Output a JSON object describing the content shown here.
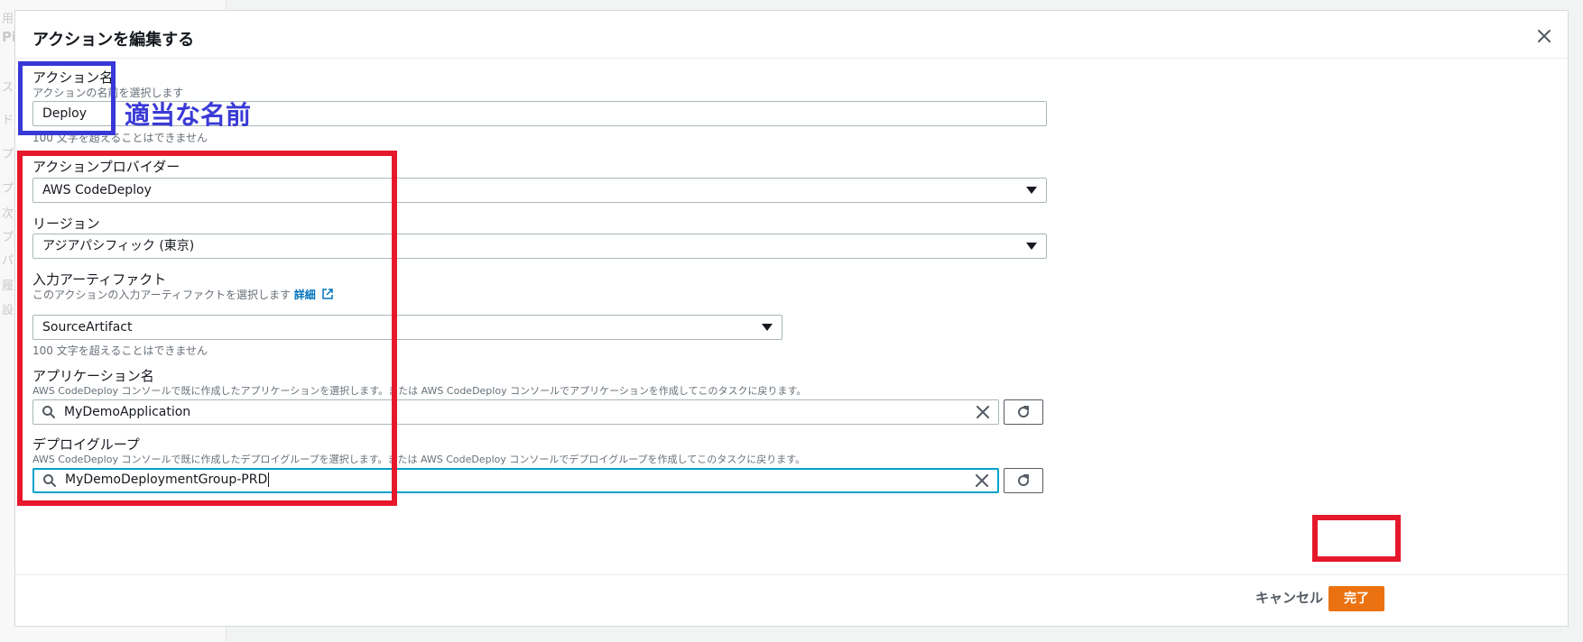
{
  "background": {
    "ghost_chars": [
      "用",
      "Pi",
      "ス",
      "ド",
      "プ",
      "プ",
      "次",
      "プ",
      "パ",
      "履",
      "設"
    ]
  },
  "modal": {
    "title": "アクションを編集する",
    "action_name": {
      "label": "アクション名",
      "description": "アクションの名前を選択します",
      "value": "Deploy",
      "constraint": "100 文字を超えることはできません"
    },
    "action_provider": {
      "label": "アクションプロバイダー",
      "value": "AWS CodeDeploy"
    },
    "region": {
      "label": "リージョン",
      "value": "アジアパシフィック (東京)"
    },
    "input_artifact": {
      "label": "入力アーティファクト",
      "description": "このアクションの入力アーティファクトを選択します",
      "link": "詳細",
      "value": "SourceArtifact",
      "constraint": "100 文字を超えることはできません"
    },
    "application_name": {
      "label": "アプリケーション名",
      "description": "AWS CodeDeploy コンソールで既に作成したアプリケーションを選択します。または AWS CodeDeploy コンソールでアプリケーションを作成してこのタスクに戻ります。",
      "value": "MyDemoApplication"
    },
    "deployment_group": {
      "label": "デプロイグループ",
      "description": "AWS CodeDeploy コンソールで既に作成したデプロイグループを選択します。または AWS CodeDeploy コンソールでデプロイグループを作成してこのタスクに戻ります。",
      "value": "MyDemoDeploymentGroup-PRD"
    },
    "footer": {
      "cancel_label": "キャンセル",
      "done_label": "完了"
    }
  },
  "annotations": {
    "name_note": "適当な名前"
  },
  "colors": {
    "primary_button": "#ec7211",
    "focus": "#00a1c9",
    "link": "#0073bb",
    "annotation_blue": "#3838d6",
    "annotation_red": "#e6182b"
  },
  "icons": [
    "close-icon",
    "search-icon",
    "clear-icon",
    "refresh-icon",
    "external-link-icon",
    "caret-down-icon"
  ]
}
